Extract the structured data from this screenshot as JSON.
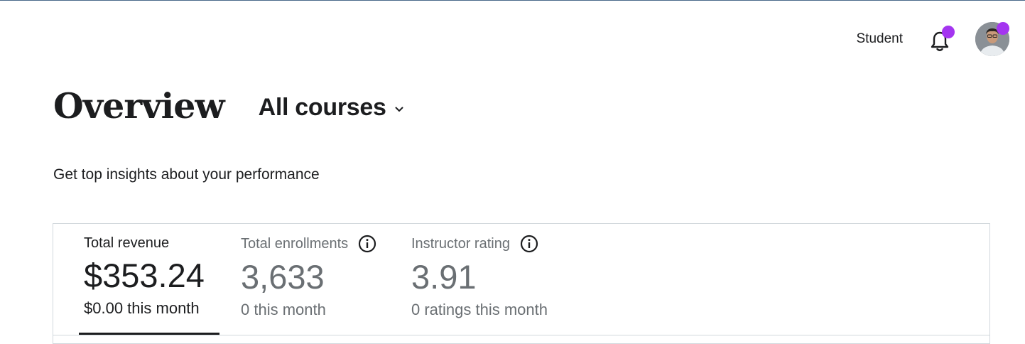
{
  "header": {
    "student_label": "Student",
    "notification_dot_color": "#a435f0",
    "bell_icon": "bell-icon",
    "avatar_icon": "user-avatar"
  },
  "overview": {
    "title": "Overview",
    "course_filter": "All courses",
    "subtitle": "Get top insights about your performance"
  },
  "stats": [
    {
      "label": "Total revenue",
      "value": "$353.24",
      "sub": "$0.00 this month",
      "active": true
    },
    {
      "label": "Total enrollments",
      "value": "3,633",
      "sub": "0 this month",
      "active": false
    },
    {
      "label": "Instructor rating",
      "value": "3.91",
      "sub": "0 ratings this month",
      "active": false
    }
  ],
  "colors": {
    "accent": "#a435f0",
    "text": "#1c1d1f",
    "muted": "#6a6f73",
    "border": "#d1d7dc"
  }
}
